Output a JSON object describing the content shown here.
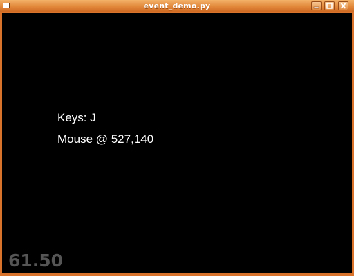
{
  "window": {
    "title": "event_demo.py",
    "controls": {
      "minimize_icon": "minimize-icon",
      "maximize_icon": "maximize-icon",
      "close_icon": "close-icon"
    },
    "colors": {
      "titlebar": "#e2893b",
      "client_background": "#000000"
    }
  },
  "content": {
    "keys_text": "Keys: J",
    "mouse_text": "Mouse @ 527,140",
    "fps_text": "61.50",
    "text_color": "#ffffff",
    "fps_color": "#555555"
  }
}
